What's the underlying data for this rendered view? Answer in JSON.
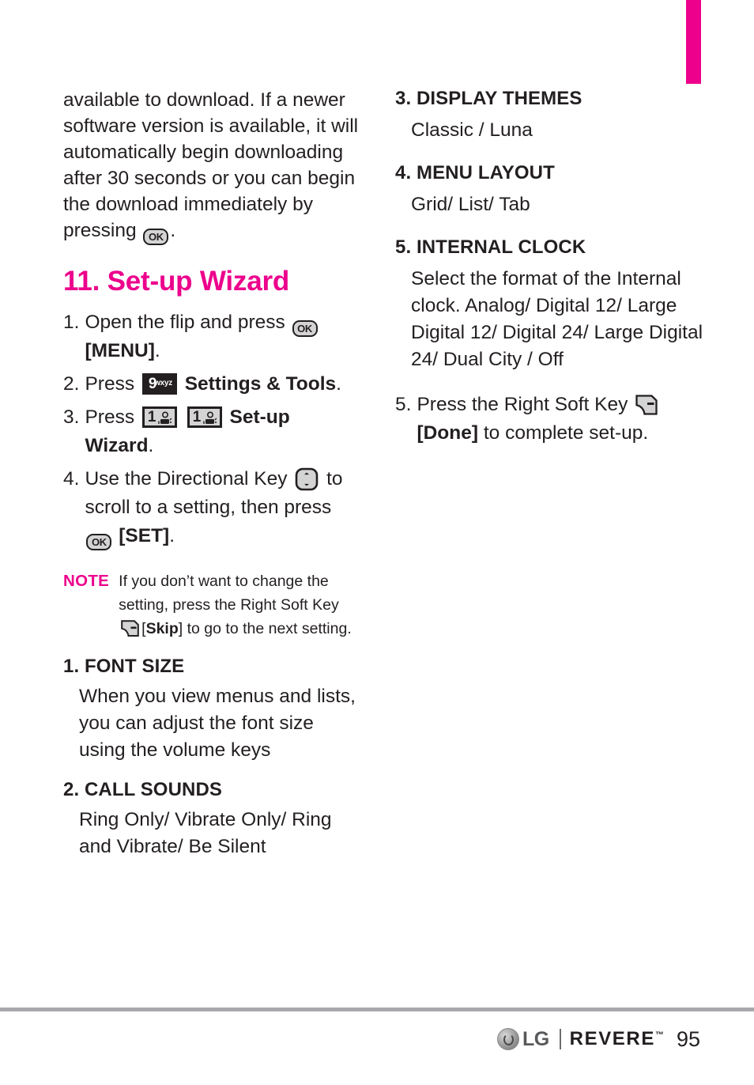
{
  "page": {
    "number": "95",
    "accent_color": "#ec008c",
    "rule_color": "#a7a9ac"
  },
  "footer": {
    "lg_text": "LG",
    "product": "REVERE",
    "trademark": "™",
    "page_number": "95"
  },
  "left_column": {
    "continued_paragraph": "available to download. If a newer software version is available, it will automatically begin downloading after 30 seconds or you can begin the download immediately by pressing",
    "continued_paragraph_tail": ".",
    "chapter_title": "11. Set-up Wizard",
    "steps": [
      {
        "num": "1.",
        "pre": "Open the flip and press",
        "key": "ok-key",
        "post_bold": "[MENU]",
        "tail": "."
      },
      {
        "num": "2.",
        "pre": "Press",
        "key": "key-9-wxyz",
        "post_bold": "Settings & Tools",
        "tail": "."
      },
      {
        "num": "3.",
        "pre": "Press",
        "key": "key-1-voicemail",
        "key2": "key-1-voicemail",
        "post_bold": "Set-up Wizard",
        "tail": "."
      },
      {
        "num": "4.",
        "pre": "Use the Directional Key",
        "key": "directional-key",
        "mid": "to scroll to a setting, then press",
        "key2": "ok-key",
        "post_bold": "[SET]",
        "tail": "."
      }
    ],
    "note": {
      "label": "NOTE",
      "text_before_key": "If you don’t want to change the setting, press the Right Soft Key",
      "key": "right-soft-key",
      "bracket_open": "[",
      "bold_word": "Skip",
      "bracket_close": "]",
      "text_after_key": "to go to the next setting."
    },
    "sections": [
      {
        "heading": "1. FONT SIZE",
        "body": "When you view menus and lists, you can adjust the font size using the volume keys"
      },
      {
        "heading": "2. CALL SOUNDS",
        "body": "Ring Only/ Vibrate Only/ Ring and Vibrate/ Be Silent"
      }
    ]
  },
  "right_column": {
    "sections": [
      {
        "heading": "3. DISPLAY THEMES",
        "body": "Classic / Luna"
      },
      {
        "heading": "4. MENU LAYOUT",
        "body": "Grid/ List/ Tab"
      },
      {
        "heading": "5. INTERNAL CLOCK",
        "body": "Select the format of the Internal clock. Analog/ Digital 12/ Large Digital 12/ Digital 24/ Large Digital 24/ Dual City / Off"
      }
    ],
    "final_step": {
      "num": "5.",
      "pre": "Press the Right Soft Key",
      "key": "right-soft-key",
      "post_bold": "[Done]",
      "tail": "to complete set-up."
    }
  },
  "keys": {
    "ok_label": "OK",
    "nine_digit": "9",
    "nine_letters": "wxyz",
    "one_digit": "1"
  }
}
